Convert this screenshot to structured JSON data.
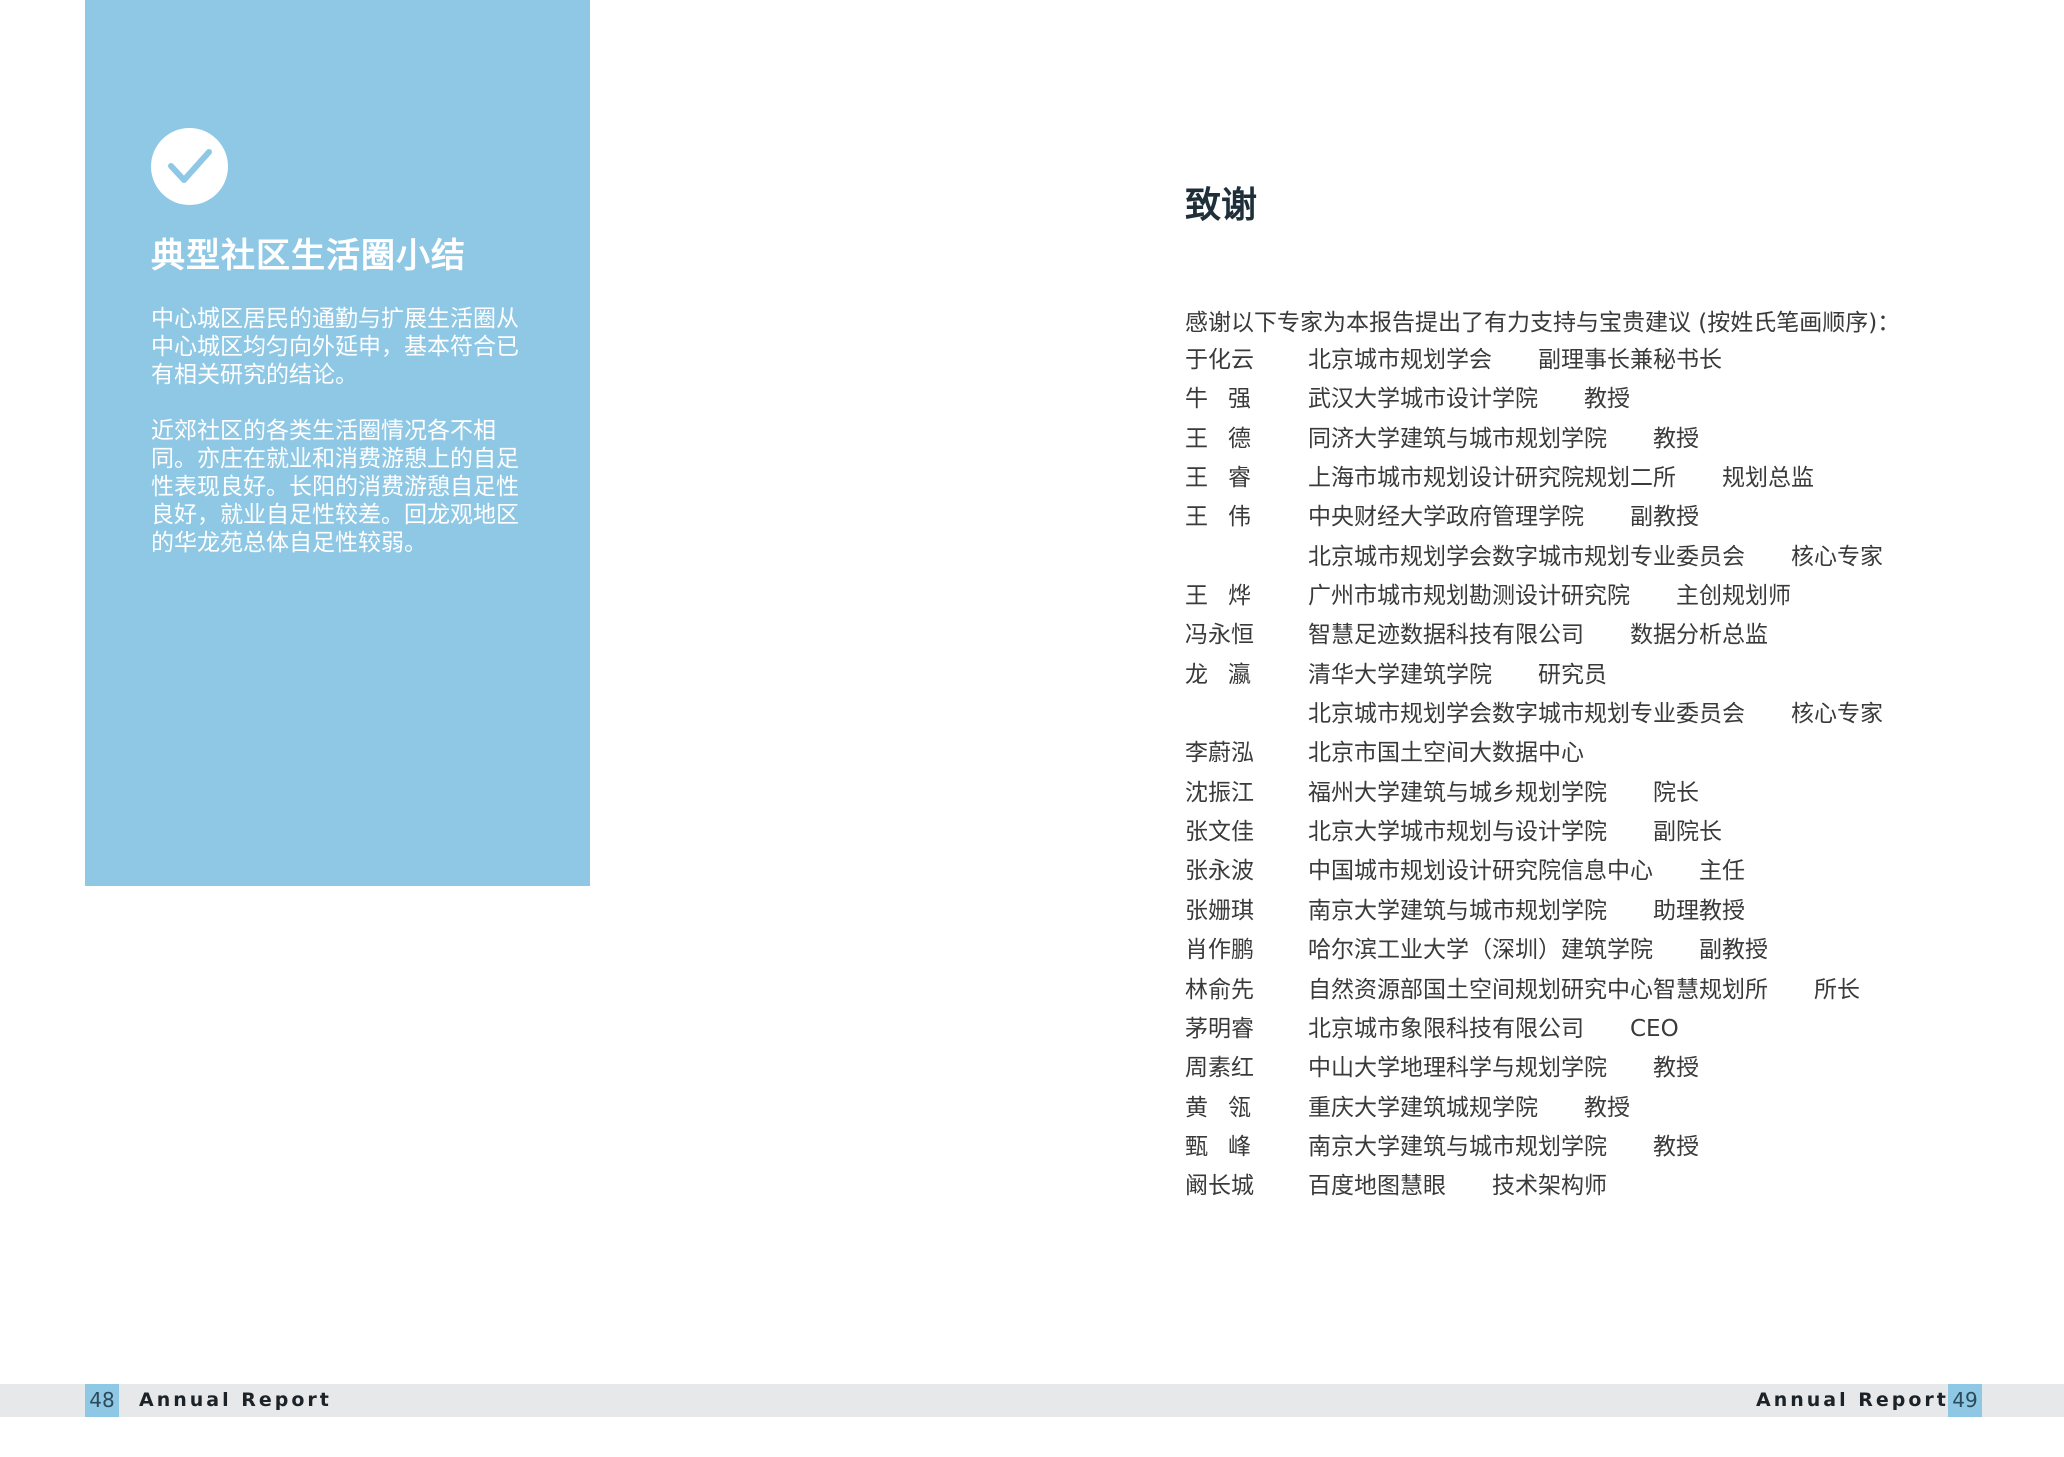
{
  "left_page": {
    "title": "典型社区生活圈小结",
    "paragraphs": [
      "中心城区居民的通勤与扩展生活圈从中心城区均匀向外延申，基本符合已有相关研究的结论。",
      "近郊社区的各类生活圈情况各不相同。亦庄在就业和消费游憩上的自足性表现良好。长阳的消费游憩自足性良好，就业自足性较差。回龙观地区的华龙苑总体自足性较弱。"
    ],
    "page_number": "48",
    "footer_label": "Annual Report"
  },
  "right_page": {
    "title": "致谢",
    "intro": "感谢以下专家为本报告提出了有力支持与宝贵建议 (按姓氏笔画顺序)：",
    "acknowledgements": [
      {
        "name": "于化云",
        "org": "北京城市规划学会",
        "role": "副理事长兼秘书长"
      },
      {
        "name": "牛强",
        "org": "武汉大学城市设计学院",
        "role": "教授"
      },
      {
        "name": "王德",
        "org": "同济大学建筑与城市规划学院",
        "role": "教授"
      },
      {
        "name": "王睿",
        "org": "上海市城市规划设计研究院规划二所",
        "role": "规划总监"
      },
      {
        "name": "王伟",
        "org": "中央财经大学政府管理学院",
        "role": "副教授"
      },
      {
        "name": "",
        "org": "北京城市规划学会数字城市规划专业委员会",
        "role": "核心专家"
      },
      {
        "name": "王烨",
        "org": "广州市城市规划勘测设计研究院",
        "role": "主创规划师"
      },
      {
        "name": "冯永恒",
        "org": "智慧足迹数据科技有限公司",
        "role": "数据分析总监"
      },
      {
        "name": "龙瀛",
        "org": "清华大学建筑学院",
        "role": "研究员"
      },
      {
        "name": "",
        "org": "北京城市规划学会数字城市规划专业委员会",
        "role": "核心专家"
      },
      {
        "name": "李蔚泓",
        "org": "北京市国土空间大数据中心",
        "role": ""
      },
      {
        "name": "沈振江",
        "org": "福州大学建筑与城乡规划学院",
        "role": "院长"
      },
      {
        "name": "张文佳",
        "org": "北京大学城市规划与设计学院",
        "role": "副院长"
      },
      {
        "name": "张永波",
        "org": "中国城市规划设计研究院信息中心",
        "role": "主任"
      },
      {
        "name": "张姗琪",
        "org": "南京大学建筑与城市规划学院",
        "role": "助理教授"
      },
      {
        "name": "肖作鹏",
        "org": "哈尔滨工业大学（深圳）建筑学院",
        "role": "副教授"
      },
      {
        "name": "林俞先",
        "org": "自然资源部国土空间规划研究中心智慧规划所",
        "role": "所长"
      },
      {
        "name": "茅明睿",
        "org": "北京城市象限科技有限公司",
        "role": "CEO"
      },
      {
        "name": "周素红",
        "org": "中山大学地理科学与规划学院",
        "role": "教授"
      },
      {
        "name": "黄瓴",
        "org": "重庆大学建筑城规学院",
        "role": "教授"
      },
      {
        "name": "甄峰",
        "org": "南京大学建筑与城市规划学院",
        "role": "教授"
      },
      {
        "name": "阚长城",
        "org": "百度地图慧眼",
        "role": "技术架构师"
      }
    ],
    "page_number": "49",
    "footer_label": "Annual Report"
  },
  "colors": {
    "panel_blue": "#8fc8e5",
    "footer_gray": "#e7e8e9",
    "title_dark": "#1f2f3a"
  },
  "icons": {
    "summary_icon": "check-circle-icon"
  }
}
